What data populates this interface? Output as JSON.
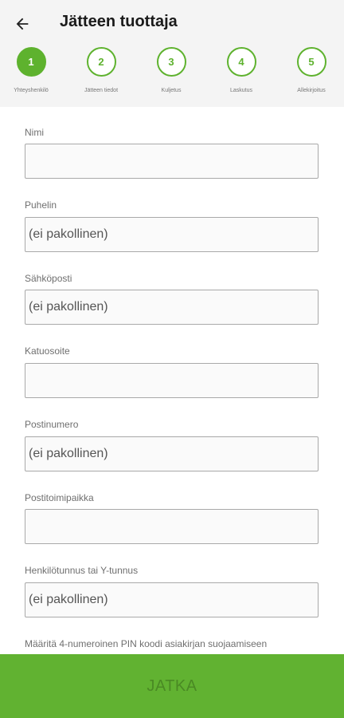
{
  "header": {
    "back_icon": "arrow-left-icon",
    "title": "Jätteen tuottaja"
  },
  "colors": {
    "accent": "#5eb22e",
    "cta_background": "#61b231",
    "cta_text": "#4a8a24",
    "header_background": "#f4f4f4"
  },
  "stepper": {
    "active_step": 1,
    "steps": [
      {
        "number": "1",
        "label": "Yhteyshenkilö"
      },
      {
        "number": "2",
        "label": "Jätteen tiedot"
      },
      {
        "number": "3",
        "label": "Kuljetus"
      },
      {
        "number": "4",
        "label": "Laskutus"
      },
      {
        "number": "5",
        "label": "Allekirjoitus"
      }
    ]
  },
  "form": {
    "fields": [
      {
        "label": "Nimi",
        "placeholder": "",
        "value": ""
      },
      {
        "label": "Puhelin",
        "placeholder": "(ei pakollinen)",
        "value": ""
      },
      {
        "label": "Sähköposti",
        "placeholder": "(ei pakollinen)",
        "value": ""
      },
      {
        "label": "Katuosoite",
        "placeholder": "",
        "value": ""
      },
      {
        "label": "Postinumero",
        "placeholder": "(ei pakollinen)",
        "value": ""
      },
      {
        "label": "Postitoimipaikka",
        "placeholder": "",
        "value": ""
      },
      {
        "label": "Henkilötunnus tai Y-tunnus",
        "placeholder": "(ei pakollinen)",
        "value": ""
      }
    ],
    "pin_note": "Määritä 4-numeroinen PIN koodi asiakirjan suojaamiseen"
  },
  "actions": {
    "continue_label": "JATKA"
  }
}
